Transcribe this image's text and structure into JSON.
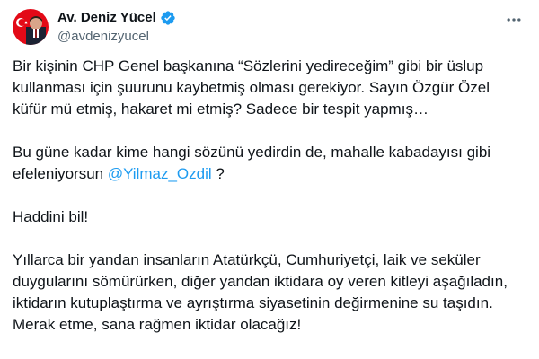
{
  "author": {
    "display_name": "Av. Deniz Yücel",
    "handle": "@avdenizyucel",
    "verified": true,
    "avatar_icon": "profile-photo-with-turkish-flag-icon"
  },
  "tweet": {
    "paragraphs": [
      {
        "lines": [
          "Bir kişinin CHP Genel başkanına “Sözlerini yedireceğim” gibi bir üslup",
          "kullanması için şuurunu kaybetmiş olması gerekiyor. Sayın Özgür Özel",
          "küfür mü etmiş, hakaret mi etmiş? Sadece bir tespit yapmış…"
        ]
      },
      {
        "line1": "Bu güne kadar kime hangi sözünü yedirdin de, mahalle kabadayısı gibi",
        "line2_before": "efeleniyorsun ",
        "mention": "@Yilmaz_Ozdil",
        "line2_after": " ?"
      },
      {
        "lines": [
          "Haddini bil!"
        ]
      },
      {
        "lines": [
          "Yıllarca bir yandan insanların Atatürkçü, Cumhuriyetçi, laik ve seküler",
          "duygularını sömürürken, diğer yandan iktidara oy veren kitleyi aşağıladın,",
          "iktidarın kutuplaştırma ve ayrıştırma siyasetinin değirmenine su taşıdın.",
          "Merak etme, sana rağmen iktidar olacağız!"
        ]
      }
    ]
  },
  "colors": {
    "text": "#0f1419",
    "secondary": "#536471",
    "accent": "#1d9bf0",
    "flag_red": "#e30a17"
  },
  "icons": {
    "verified": "verified-badge-icon",
    "more": "more-options-icon"
  }
}
